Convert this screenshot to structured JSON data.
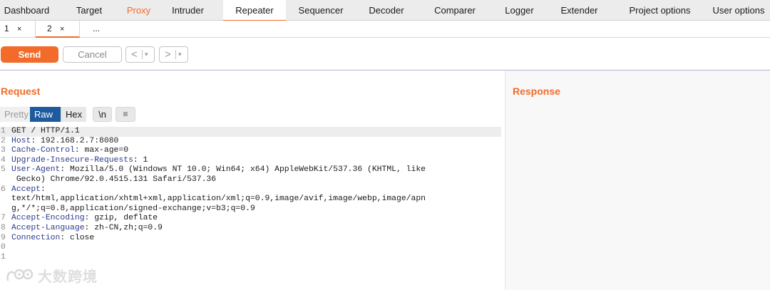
{
  "tool_tabs": [
    {
      "label": "Dashboard",
      "active": false,
      "accent": false
    },
    {
      "label": "Target",
      "active": false,
      "accent": false
    },
    {
      "label": "Proxy",
      "active": false,
      "accent": true
    },
    {
      "label": "Intruder",
      "active": false,
      "accent": false
    },
    {
      "label": "Repeater",
      "active": true,
      "accent": false
    },
    {
      "label": "Sequencer",
      "active": false,
      "accent": false
    },
    {
      "label": "Decoder",
      "active": false,
      "accent": false
    },
    {
      "label": "Comparer",
      "active": false,
      "accent": false
    },
    {
      "label": "Logger",
      "active": false,
      "accent": false
    },
    {
      "label": "Extender",
      "active": false,
      "accent": false
    },
    {
      "label": "Project options",
      "active": false,
      "accent": false
    },
    {
      "label": "User options",
      "active": false,
      "accent": false
    }
  ],
  "sub_tabs": [
    {
      "label": "1",
      "close": "×",
      "active": false
    },
    {
      "label": "2",
      "close": "×",
      "active": true
    },
    {
      "label": "...",
      "close": "",
      "active": false
    }
  ],
  "toolbar": {
    "send_label": "Send",
    "cancel_label": "Cancel",
    "back_arrow": "<",
    "forward_arrow": ">",
    "dropdown_glyph": "▾"
  },
  "request": {
    "title": "Request",
    "view_tabs": {
      "pretty": "Pretty",
      "raw": "Raw",
      "hex": "Hex",
      "newline": "\\n",
      "menu": "≡"
    },
    "lines": [
      {
        "num": "1",
        "name": "",
        "value": "GET / HTTP/1.1"
      },
      {
        "num": "2",
        "name": "Host",
        "value": ": 192.168.2.7:8080"
      },
      {
        "num": "3",
        "name": "Cache-Control",
        "value": ": max-age=0"
      },
      {
        "num": "4",
        "name": "Upgrade-Insecure-Requests",
        "value": ": 1"
      },
      {
        "num": "5",
        "name": "User-Agent",
        "value": ": Mozilla/5.0 (Windows NT 10.0; Win64; x64) AppleWebKit/537.36 (KHTML, like"
      },
      {
        "num": "",
        "name": "",
        "value": " Gecko) Chrome/92.0.4515.131 Safari/537.36"
      },
      {
        "num": "6",
        "name": "Accept",
        "value": ":"
      },
      {
        "num": "",
        "name": "",
        "value": "text/html,application/xhtml+xml,application/xml;q=0.9,image/avif,image/webp,image/apn"
      },
      {
        "num": "",
        "name": "",
        "value": "g,*/*;q=0.8,application/signed-exchange;v=b3;q=0.9"
      },
      {
        "num": "7",
        "name": "Accept-Encoding",
        "value": ": gzip, deflate"
      },
      {
        "num": "8",
        "name": "Accept-Language",
        "value": ": zh-CN,zh;q=0.9"
      },
      {
        "num": "9",
        "name": "Connection",
        "value": ": close"
      },
      {
        "num": "0",
        "name": "",
        "value": ""
      },
      {
        "num": "1",
        "name": "",
        "value": ""
      }
    ]
  },
  "response": {
    "title": "Response"
  },
  "watermark": {
    "text": "大数跨境",
    "icon": "brand-logo-icon"
  },
  "colors": {
    "accent": "#f26b2a",
    "raw_tab": "#1d5a9e",
    "header_name": "#2b3a8c"
  }
}
